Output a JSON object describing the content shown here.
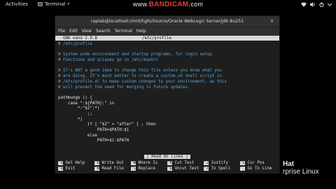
{
  "topbar": {
    "activities": "Activities",
    "app_name": "Terminal",
    "arrow": "▾"
  },
  "watermark": {
    "www": "www.",
    "brand": "BANDICAM",
    "tld": ".com"
  },
  "window": {
    "title": "raplab@localhost:/mnt/hgfs/Source/Oracle WebLogic Server/jdk-8u251",
    "close": "×",
    "menu": [
      "File",
      "Edit",
      "View",
      "Search",
      "Terminal",
      "Help"
    ]
  },
  "nano": {
    "version": "  GNU nano 2.9.8",
    "filename": "/etc/profile",
    "lines": [
      {
        "text": "# /etc/profile",
        "type": "comment"
      },
      {
        "text": "",
        "type": "code"
      },
      {
        "text": "# System wide environment and startup programs, for login setup",
        "type": "comment"
      },
      {
        "text": "# Functions and aliases go in /etc/bashrc",
        "type": "comment"
      },
      {
        "text": "",
        "type": "code"
      },
      {
        "text": "# It's NOT a good idea to change this file unless you know what you",
        "type": "comment"
      },
      {
        "text": "# are doing. It's much better to create a custom.sh shell script in",
        "type": "comment"
      },
      {
        "text": "# /etc/profile.d/ to make custom changes to your environment, as this",
        "type": "comment"
      },
      {
        "text": "# will prevent the need for merging in future updates.",
        "type": "comment"
      },
      {
        "text": "",
        "type": "code"
      },
      {
        "text": "pathmunge () {",
        "type": "code"
      },
      {
        "text": "    case \":${PATH}:\" in",
        "type": "code"
      },
      {
        "text": "        *:\"$1\":*)",
        "type": "code"
      },
      {
        "text": "            ;;",
        "type": "code"
      },
      {
        "text": "        *)",
        "type": "code"
      },
      {
        "text": "            if [ \"$2\" = \"after\" ] ; then",
        "type": "code"
      },
      {
        "text": "                PATH=$PATH:$1",
        "type": "code"
      },
      {
        "text": "            else",
        "type": "code"
      },
      {
        "text": "                PATH=$1:$PATH",
        "type": "code"
      }
    ],
    "status": "[ Read 85 lines ]",
    "shortcuts": [
      [
        {
          "key": "^G",
          "label": " Get Help"
        },
        {
          "key": "^O",
          "label": " Write Out"
        },
        {
          "key": "^W",
          "label": " Where Is"
        },
        {
          "key": "^K",
          "label": " Cut Text"
        },
        {
          "key": "^J",
          "label": " Justify"
        },
        {
          "key": "^C",
          "label": " Cur Pos"
        }
      ],
      [
        {
          "key": "^X",
          "label": " Exit"
        },
        {
          "key": "^R",
          "label": " Read File"
        },
        {
          "key": "^\\",
          "label": " Replace"
        },
        {
          "key": "^U",
          "label": " Uncut Text"
        },
        {
          "key": "^T",
          "label": " To Spell"
        },
        {
          "key": "^_",
          "label": " Go To Line"
        }
      ]
    ]
  },
  "desktop_logo": {
    "line1": "Hat",
    "line2": "rprise Linux"
  },
  "tray_icons": [
    "network-icon",
    "volume-icon",
    "power-icon",
    "chevron-down-icon"
  ]
}
